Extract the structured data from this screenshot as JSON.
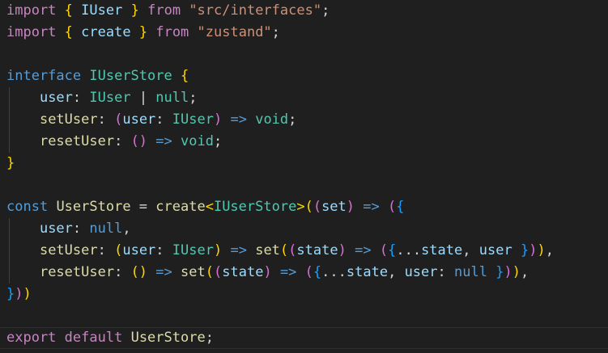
{
  "editor": {
    "background": "#1f1f1f",
    "colors": {
      "keyword": "#569cd6",
      "control": "#c586c0",
      "type": "#4ec9b0",
      "string": "#ce9178",
      "variable": "#9cdcfe",
      "function": "#dcdcaa",
      "const": "#4fc1ff",
      "plain": "#d4d4d4",
      "bracket1": "#ffd700",
      "bracket2": "#da70d6",
      "bracket3": "#179fff"
    },
    "lines": [
      {
        "tokens": [
          {
            "t": "import",
            "c": "control"
          },
          {
            "t": " ",
            "c": "plain"
          },
          {
            "t": "{",
            "c": "bracket1"
          },
          {
            "t": " ",
            "c": "plain"
          },
          {
            "t": "IUser",
            "c": "variable"
          },
          {
            "t": " ",
            "c": "plain"
          },
          {
            "t": "}",
            "c": "bracket1"
          },
          {
            "t": " ",
            "c": "plain"
          },
          {
            "t": "from",
            "c": "control"
          },
          {
            "t": " ",
            "c": "plain"
          },
          {
            "t": "\"src/interfaces\"",
            "c": "string"
          },
          {
            "t": ";",
            "c": "plain"
          }
        ]
      },
      {
        "tokens": [
          {
            "t": "import",
            "c": "control"
          },
          {
            "t": " ",
            "c": "plain"
          },
          {
            "t": "{",
            "c": "bracket1"
          },
          {
            "t": " ",
            "c": "plain"
          },
          {
            "t": "create",
            "c": "variable"
          },
          {
            "t": " ",
            "c": "plain"
          },
          {
            "t": "}",
            "c": "bracket1"
          },
          {
            "t": " ",
            "c": "plain"
          },
          {
            "t": "from",
            "c": "control"
          },
          {
            "t": " ",
            "c": "plain"
          },
          {
            "t": "\"zustand\"",
            "c": "string"
          },
          {
            "t": ";",
            "c": "plain"
          }
        ]
      },
      {
        "tokens": []
      },
      {
        "tokens": [
          {
            "t": "interface",
            "c": "keyword"
          },
          {
            "t": " ",
            "c": "plain"
          },
          {
            "t": "IUserStore",
            "c": "type"
          },
          {
            "t": " ",
            "c": "plain"
          },
          {
            "t": "{",
            "c": "bracket1"
          }
        ]
      },
      {
        "indent": true,
        "tokens": [
          {
            "t": "    ",
            "c": "plain"
          },
          {
            "t": "user",
            "c": "variable"
          },
          {
            "t": ": ",
            "c": "plain"
          },
          {
            "t": "IUser",
            "c": "type"
          },
          {
            "t": " | ",
            "c": "plain"
          },
          {
            "t": "null",
            "c": "type"
          },
          {
            "t": ";",
            "c": "plain"
          }
        ]
      },
      {
        "indent": true,
        "tokens": [
          {
            "t": "    ",
            "c": "plain"
          },
          {
            "t": "setUser",
            "c": "function"
          },
          {
            "t": ": ",
            "c": "plain"
          },
          {
            "t": "(",
            "c": "bracket2"
          },
          {
            "t": "user",
            "c": "variable"
          },
          {
            "t": ": ",
            "c": "plain"
          },
          {
            "t": "IUser",
            "c": "type"
          },
          {
            "t": ")",
            "c": "bracket2"
          },
          {
            "t": " ",
            "c": "plain"
          },
          {
            "t": "=>",
            "c": "keyword"
          },
          {
            "t": " ",
            "c": "plain"
          },
          {
            "t": "void",
            "c": "type"
          },
          {
            "t": ";",
            "c": "plain"
          }
        ]
      },
      {
        "indent": true,
        "tokens": [
          {
            "t": "    ",
            "c": "plain"
          },
          {
            "t": "resetUser",
            "c": "function"
          },
          {
            "t": ": ",
            "c": "plain"
          },
          {
            "t": "()",
            "c": "bracket2"
          },
          {
            "t": " ",
            "c": "plain"
          },
          {
            "t": "=>",
            "c": "keyword"
          },
          {
            "t": " ",
            "c": "plain"
          },
          {
            "t": "void",
            "c": "type"
          },
          {
            "t": ";",
            "c": "plain"
          }
        ]
      },
      {
        "tokens": [
          {
            "t": "}",
            "c": "bracket1"
          }
        ]
      },
      {
        "tokens": []
      },
      {
        "tokens": [
          {
            "t": "const",
            "c": "keyword"
          },
          {
            "t": " ",
            "c": "plain"
          },
          {
            "t": "UserStore",
            "c": "function"
          },
          {
            "t": " = ",
            "c": "plain"
          },
          {
            "t": "create",
            "c": "function"
          },
          {
            "t": "<",
            "c": "bracket1"
          },
          {
            "t": "IUserStore",
            "c": "type"
          },
          {
            "t": ">",
            "c": "bracket1"
          },
          {
            "t": "(",
            "c": "bracket1"
          },
          {
            "t": "(",
            "c": "bracket2"
          },
          {
            "t": "set",
            "c": "variable"
          },
          {
            "t": ")",
            "c": "bracket2"
          },
          {
            "t": " ",
            "c": "plain"
          },
          {
            "t": "=>",
            "c": "keyword"
          },
          {
            "t": " ",
            "c": "plain"
          },
          {
            "t": "(",
            "c": "bracket2"
          },
          {
            "t": "{",
            "c": "bracket3"
          }
        ]
      },
      {
        "indent": true,
        "tokens": [
          {
            "t": "    ",
            "c": "plain"
          },
          {
            "t": "user",
            "c": "variable"
          },
          {
            "t": ": ",
            "c": "plain"
          },
          {
            "t": "null",
            "c": "keyword"
          },
          {
            "t": ",",
            "c": "plain"
          }
        ]
      },
      {
        "indent": true,
        "tokens": [
          {
            "t": "    ",
            "c": "plain"
          },
          {
            "t": "setUser",
            "c": "function"
          },
          {
            "t": ": ",
            "c": "plain"
          },
          {
            "t": "(",
            "c": "bracket1"
          },
          {
            "t": "user",
            "c": "variable"
          },
          {
            "t": ": ",
            "c": "plain"
          },
          {
            "t": "IUser",
            "c": "type"
          },
          {
            "t": ")",
            "c": "bracket1"
          },
          {
            "t": " ",
            "c": "plain"
          },
          {
            "t": "=>",
            "c": "keyword"
          },
          {
            "t": " ",
            "c": "plain"
          },
          {
            "t": "set",
            "c": "function"
          },
          {
            "t": "(",
            "c": "bracket1"
          },
          {
            "t": "(",
            "c": "bracket2"
          },
          {
            "t": "state",
            "c": "variable"
          },
          {
            "t": ")",
            "c": "bracket2"
          },
          {
            "t": " ",
            "c": "plain"
          },
          {
            "t": "=>",
            "c": "keyword"
          },
          {
            "t": " ",
            "c": "plain"
          },
          {
            "t": "(",
            "c": "bracket2"
          },
          {
            "t": "{",
            "c": "bracket3"
          },
          {
            "t": "...",
            "c": "plain"
          },
          {
            "t": "state",
            "c": "variable"
          },
          {
            "t": ", ",
            "c": "plain"
          },
          {
            "t": "user",
            "c": "variable"
          },
          {
            "t": " ",
            "c": "plain"
          },
          {
            "t": "}",
            "c": "bracket3"
          },
          {
            "t": ")",
            "c": "bracket2"
          },
          {
            "t": ")",
            "c": "bracket1"
          },
          {
            "t": ",",
            "c": "plain"
          }
        ]
      },
      {
        "indent": true,
        "tokens": [
          {
            "t": "    ",
            "c": "plain"
          },
          {
            "t": "resetUser",
            "c": "function"
          },
          {
            "t": ": ",
            "c": "plain"
          },
          {
            "t": "()",
            "c": "bracket1"
          },
          {
            "t": " ",
            "c": "plain"
          },
          {
            "t": "=>",
            "c": "keyword"
          },
          {
            "t": " ",
            "c": "plain"
          },
          {
            "t": "set",
            "c": "function"
          },
          {
            "t": "(",
            "c": "bracket1"
          },
          {
            "t": "(",
            "c": "bracket2"
          },
          {
            "t": "state",
            "c": "variable"
          },
          {
            "t": ")",
            "c": "bracket2"
          },
          {
            "t": " ",
            "c": "plain"
          },
          {
            "t": "=>",
            "c": "keyword"
          },
          {
            "t": " ",
            "c": "plain"
          },
          {
            "t": "(",
            "c": "bracket2"
          },
          {
            "t": "{",
            "c": "bracket3"
          },
          {
            "t": "...",
            "c": "plain"
          },
          {
            "t": "state",
            "c": "variable"
          },
          {
            "t": ", ",
            "c": "plain"
          },
          {
            "t": "user",
            "c": "variable"
          },
          {
            "t": ": ",
            "c": "plain"
          },
          {
            "t": "null",
            "c": "keyword"
          },
          {
            "t": " ",
            "c": "plain"
          },
          {
            "t": "}",
            "c": "bracket3"
          },
          {
            "t": ")",
            "c": "bracket2"
          },
          {
            "t": ")",
            "c": "bracket1"
          },
          {
            "t": ",",
            "c": "plain"
          }
        ]
      },
      {
        "tokens": [
          {
            "t": "}",
            "c": "bracket3"
          },
          {
            "t": ")",
            "c": "bracket2"
          },
          {
            "t": ")",
            "c": "bracket1"
          }
        ]
      },
      {
        "tokens": []
      },
      {
        "current": true,
        "tokens": [
          {
            "t": "export",
            "c": "control"
          },
          {
            "t": " ",
            "c": "plain"
          },
          {
            "t": "default",
            "c": "control"
          },
          {
            "t": " ",
            "c": "plain"
          },
          {
            "t": "UserStore",
            "c": "function"
          },
          {
            "t": ";",
            "c": "plain"
          }
        ]
      }
    ]
  }
}
